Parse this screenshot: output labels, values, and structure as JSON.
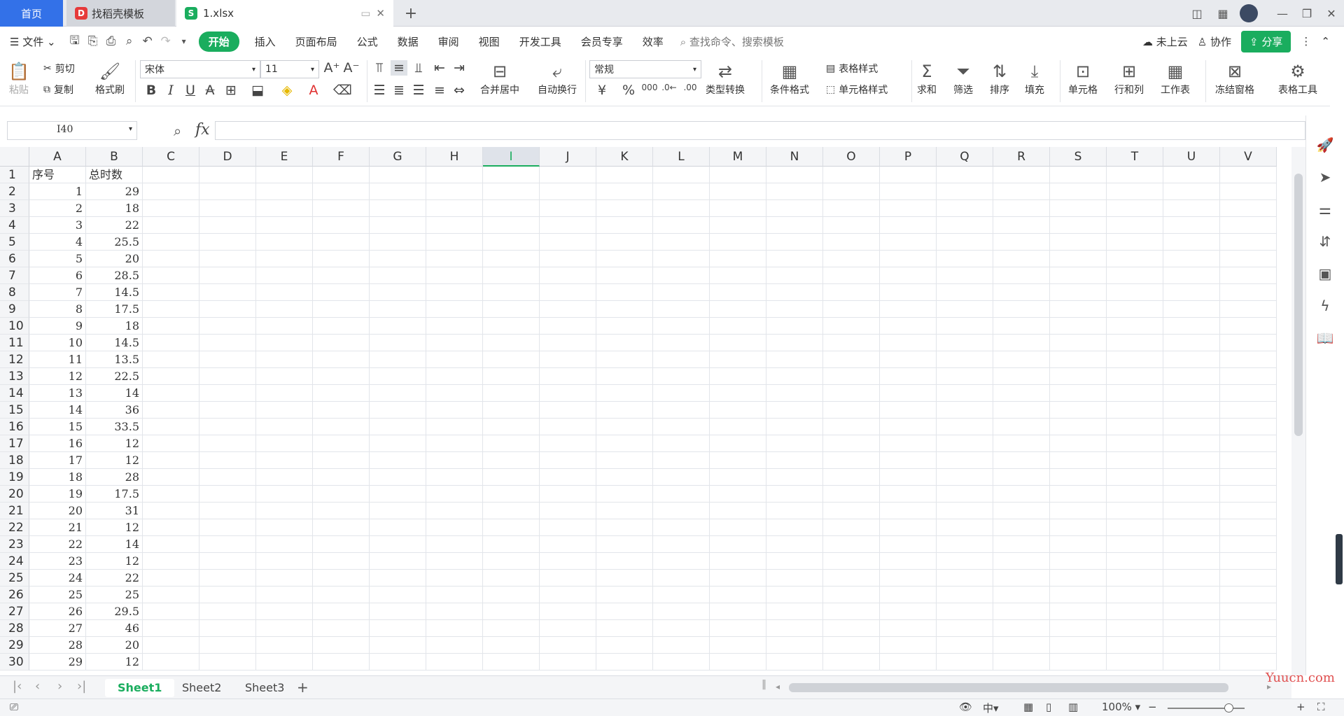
{
  "titlebar": {
    "tabs": [
      {
        "label": "首页"
      },
      {
        "label": "找稻壳模板"
      },
      {
        "label": "1.xlsx"
      }
    ]
  },
  "menu": {
    "file": "文件",
    "items": [
      "开始",
      "插入",
      "页面布局",
      "公式",
      "数据",
      "审阅",
      "视图",
      "开发工具",
      "会员专享",
      "效率"
    ],
    "search": "查找命令、搜索模板",
    "cloud": "未上云",
    "collab": "协作",
    "share": "分享"
  },
  "ribbon": {
    "paste": "粘贴",
    "cut": "剪切",
    "copy": "复制",
    "format_painter": "格式刷",
    "font_name": "宋体",
    "font_size": "11",
    "merge_center": "合并居中",
    "wrap": "自动换行",
    "number_format": "常规",
    "type_convert": "类型转换",
    "cond_format": "条件格式",
    "table_style": "表格样式",
    "cell_style": "单元格样式",
    "sum": "求和",
    "filter": "筛选",
    "sort": "排序",
    "fill": "填充",
    "cell": "单元格",
    "row_col": "行和列",
    "sheet": "工作表",
    "freeze": "冻结窗格",
    "table_tools": "表格工具"
  },
  "formula_bar": {
    "name_box": "I40",
    "fx": "fx",
    "value": ""
  },
  "columns": [
    "A",
    "B",
    "C",
    "D",
    "E",
    "F",
    "G",
    "H",
    "I",
    "J",
    "K",
    "L",
    "M",
    "N",
    "O",
    "P",
    "Q",
    "R",
    "S",
    "T",
    "U",
    "V"
  ],
  "active_column": "I",
  "rows": [
    {
      "n": "1",
      "a": "序号",
      "b": "总时数"
    },
    {
      "n": "2",
      "a": "1",
      "b": "29"
    },
    {
      "n": "3",
      "a": "2",
      "b": "18"
    },
    {
      "n": "4",
      "a": "3",
      "b": "22"
    },
    {
      "n": "5",
      "a": "4",
      "b": "25.5"
    },
    {
      "n": "6",
      "a": "5",
      "b": "20"
    },
    {
      "n": "7",
      "a": "6",
      "b": "28.5"
    },
    {
      "n": "8",
      "a": "7",
      "b": "14.5"
    },
    {
      "n": "9",
      "a": "8",
      "b": "17.5"
    },
    {
      "n": "10",
      "a": "9",
      "b": "18"
    },
    {
      "n": "11",
      "a": "10",
      "b": "14.5"
    },
    {
      "n": "12",
      "a": "11",
      "b": "13.5"
    },
    {
      "n": "13",
      "a": "12",
      "b": "22.5"
    },
    {
      "n": "14",
      "a": "13",
      "b": "14"
    },
    {
      "n": "15",
      "a": "14",
      "b": "36"
    },
    {
      "n": "16",
      "a": "15",
      "b": "33.5"
    },
    {
      "n": "17",
      "a": "16",
      "b": "12"
    },
    {
      "n": "18",
      "a": "17",
      "b": "12"
    },
    {
      "n": "19",
      "a": "18",
      "b": "28"
    },
    {
      "n": "20",
      "a": "19",
      "b": "17.5"
    },
    {
      "n": "21",
      "a": "20",
      "b": "31"
    },
    {
      "n": "22",
      "a": "21",
      "b": "12"
    },
    {
      "n": "23",
      "a": "22",
      "b": "14"
    },
    {
      "n": "24",
      "a": "23",
      "b": "12"
    },
    {
      "n": "25",
      "a": "24",
      "b": "22"
    },
    {
      "n": "26",
      "a": "25",
      "b": "25"
    },
    {
      "n": "27",
      "a": "26",
      "b": "29.5"
    },
    {
      "n": "28",
      "a": "27",
      "b": "46"
    },
    {
      "n": "29",
      "a": "28",
      "b": "20"
    },
    {
      "n": "30",
      "a": "29",
      "b": "12"
    }
  ],
  "sheets": [
    "Sheet1",
    "Sheet2",
    "Sheet3"
  ],
  "status": {
    "zoom": "100%"
  },
  "watermark": "Yuucn.com"
}
